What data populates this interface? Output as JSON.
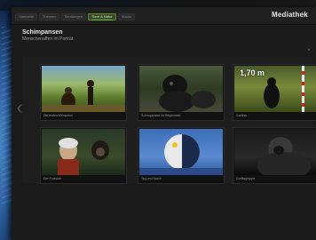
{
  "app": {
    "brand": "Mediathek",
    "title": "Schimpansen",
    "subtitle": "Menschenaffen im Porträt"
  },
  "tabs": [
    {
      "label": "Startseite",
      "active": false
    },
    {
      "label": "Themen",
      "active": false
    },
    {
      "label": "Sendungen",
      "active": false
    },
    {
      "label": "Tiere & Natur",
      "active": true
    },
    {
      "label": "Suche",
      "active": false
    }
  ],
  "thumbnails": [
    {
      "caption": "Die ersten Menschen",
      "overlay": ""
    },
    {
      "caption": "Schimpansen im Regenwald",
      "overlay": ""
    },
    {
      "caption": "Gorillas",
      "overlay": "1,70 m"
    },
    {
      "caption": "Der Forscher",
      "overlay": ""
    },
    {
      "caption": "Tag und Nacht",
      "overlay": ""
    },
    {
      "caption": "Gorillagruppe",
      "overlay": ""
    }
  ],
  "icons": {
    "close": "close-icon",
    "prev": "chevron-left-icon"
  },
  "colors": {
    "accent": "#6ec12a",
    "background": "#1b1b1b"
  }
}
